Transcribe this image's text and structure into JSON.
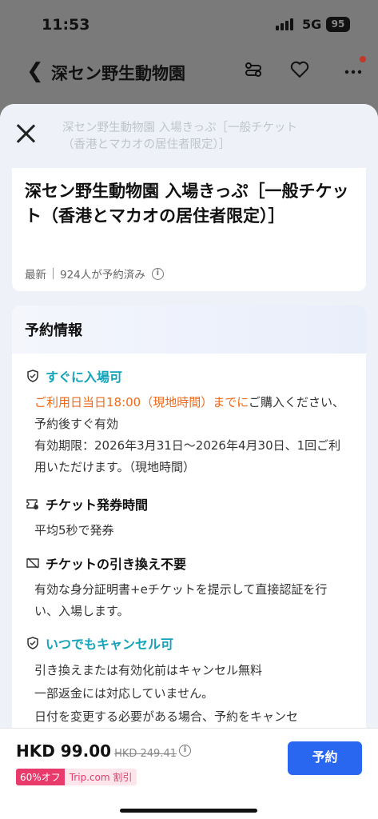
{
  "status": {
    "time": "11:53",
    "network": "5G",
    "battery": "95"
  },
  "app_header": {
    "back_icon": "chevron-left-icon",
    "title": "深セン野生動物園",
    "icons": [
      "route-icon",
      "heart-icon",
      "more-icon"
    ]
  },
  "sheet": {
    "ghost_header": "深セン野生動物園 入場きっぷ［一般チケット（香港とマカオの居住者限定）］",
    "product": {
      "title": "深セン野生動物園 入場きっぷ［一般チケット（香港とマカオの居住者限定）］",
      "tag": "最新",
      "booked": "924人が予約済み"
    },
    "booking_info": {
      "title": "予約情報",
      "instant": {
        "title": "すぐに入場可",
        "highlight": "ご利用日当日18:00（現地時間）までに",
        "rest": "ご購入ください、予約後すぐ有効",
        "validity": "有効期限：2026年3月31日～2026年4月30日、1回ご利用いただけます。（現地時間）"
      },
      "issue": {
        "title": "チケット発券時間",
        "body": "平均5秒で発券"
      },
      "exchange": {
        "title": "チケットの引き換え不要",
        "body": "有効な身分証明書+eチケットを提示して直接認証を行い、入場します。"
      },
      "cancel": {
        "title": "いつでもキャンセル可",
        "line1": "引き換えまたは有効化前はキャンセル無料",
        "line2": "一部返金には対応していません。",
        "line3": "日付を変更する必要がある場合、予約をキャンセ"
      }
    }
  },
  "bottom_bar": {
    "price": "HKD 99.00",
    "original_price": "HKD 249.41",
    "discount": "60%オフ",
    "promo": "Trip.com 割引",
    "book_label": "予約"
  },
  "colors": {
    "accent_teal": "#14a3b8",
    "orange": "#ee6a1a",
    "button_blue": "#2a67f0",
    "discount_pink": "#e83a6b"
  }
}
